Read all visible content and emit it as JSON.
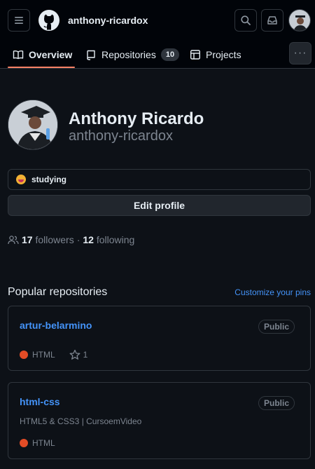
{
  "header": {
    "username": "anthony-ricardox"
  },
  "tabs": [
    {
      "label": "Overview",
      "icon": "book-icon"
    },
    {
      "label": "Repositories",
      "icon": "repo-icon",
      "count": "10"
    },
    {
      "label": "Projects",
      "icon": "table-icon"
    }
  ],
  "profile": {
    "name": "Anthony Ricardo",
    "login": "anthony-ricardox",
    "status": "studying",
    "edit_label": "Edit profile",
    "followers_count": "17",
    "followers_label": "followers",
    "separator": "·",
    "following_count": "12",
    "following_label": "following"
  },
  "popular": {
    "title": "Popular repositories",
    "customize_label": "Customize your pins",
    "repos": [
      {
        "name": "artur-belarmino",
        "visibility": "Public",
        "description": "",
        "language": "HTML",
        "language_color": "#e34c26",
        "stars": "1"
      },
      {
        "name": "html-css",
        "visibility": "Public",
        "description": "HTML5 & CSS3 | CursoemVideo",
        "language": "HTML",
        "language_color": "#e34c26",
        "stars": ""
      }
    ]
  },
  "colors": {
    "accent_link": "#4493f8",
    "tab_underline": "#f78166",
    "background": "#0d1117"
  }
}
